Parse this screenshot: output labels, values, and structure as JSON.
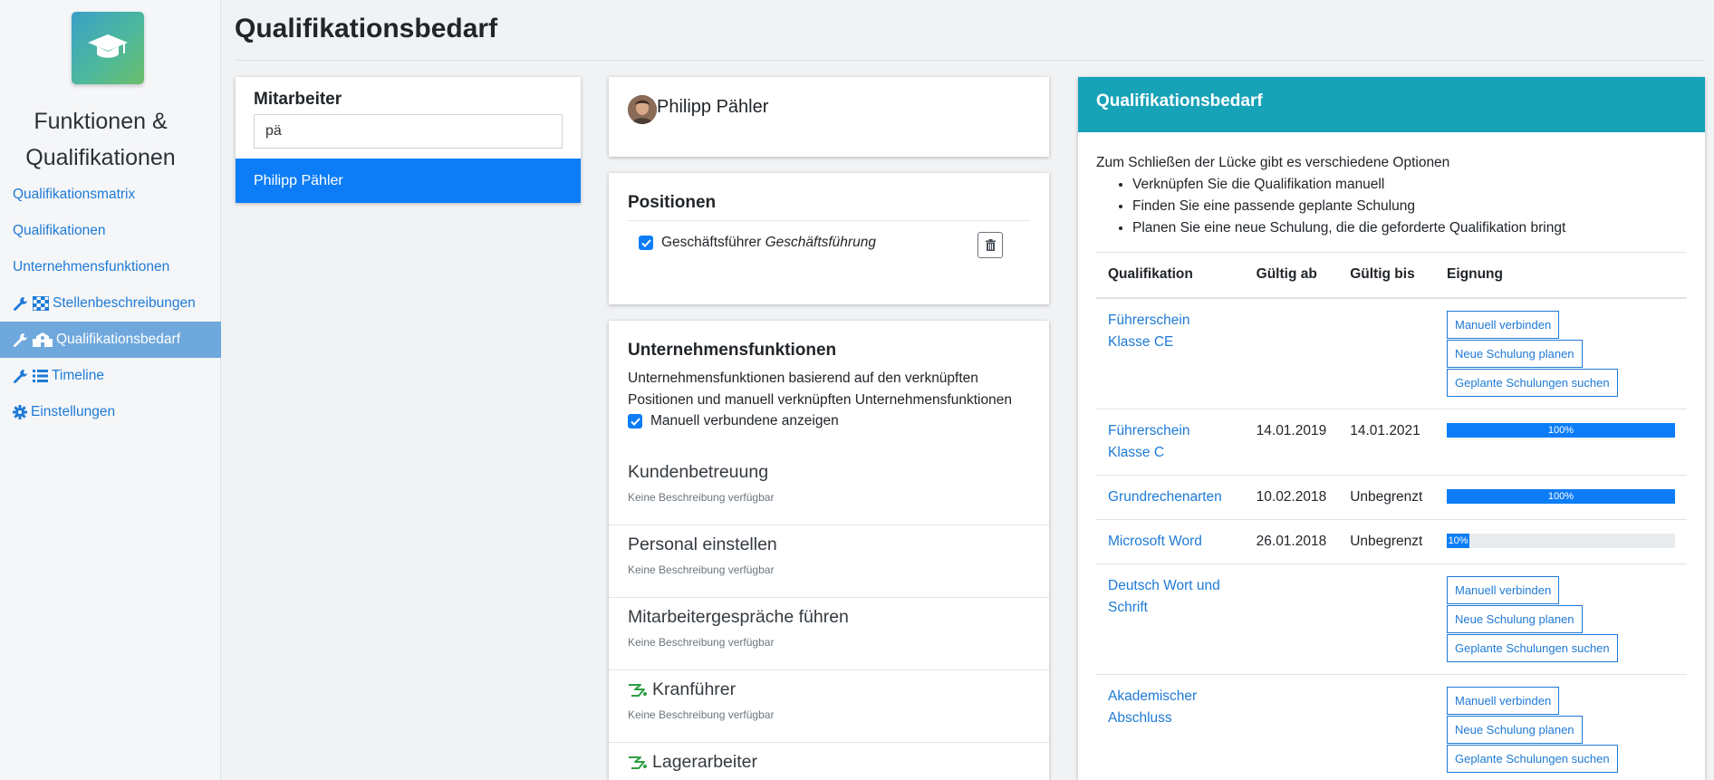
{
  "sidebar": {
    "app_title": "Funktionen & Qualifikationen",
    "items": [
      {
        "label": "Qualifikationsmatrix"
      },
      {
        "label": "Qualifikationen"
      },
      {
        "label": "Unternehmensfunktionen"
      },
      {
        "label": "Stellenbeschreibungen"
      },
      {
        "label": "Qualifikationsbedarf"
      },
      {
        "label": "Timeline"
      },
      {
        "label": "Einstellungen"
      }
    ]
  },
  "header": {
    "title": "Qualifikationsbedarf"
  },
  "mitarbeiter": {
    "heading": "Mitarbeiter",
    "search_value": "pä",
    "result": "Philipp Pähler"
  },
  "person": {
    "name": "Philipp Pähler"
  },
  "positionen": {
    "heading": "Positionen",
    "position": "Geschäftsführer",
    "department": "Geschäftsführung"
  },
  "unternehmensfunktionen": {
    "heading": "Unternehmensfunktionen",
    "description": "Unternehmensfunktionen basierend auf den verknüpften Positionen und manuell verknüpften Unternehmensfunktionen",
    "checkbox_label": "Manuell verbundene anzeigen",
    "items": [
      {
        "name": "Kundenbetreuung",
        "sub": "Keine Beschreibung verfügbar"
      },
      {
        "name": "Personal einstellen",
        "sub": "Keine Beschreibung verfügbar"
      },
      {
        "name": "Mitarbeitergespräche führen",
        "sub": "Keine Beschreibung verfügbar"
      },
      {
        "name": "Kranführer",
        "sub": "Keine Beschreibung verfügbar"
      },
      {
        "name": "Lagerarbeiter",
        "sub": ""
      }
    ]
  },
  "qualifikationsbedarf": {
    "heading": "Qualifikationsbedarf",
    "intro": "Zum Schließen der Lücke gibt es verschiedene Optionen",
    "options": [
      "Verknüpfen Sie die Qualifikation manuell",
      "Finden Sie eine passende geplante Schulung",
      "Planen Sie eine neue Schulung, die die geforderte Qualifikation bringt"
    ],
    "columns": [
      "Qualifikation",
      "Gültig ab",
      "Gültig bis",
      "Eignung"
    ],
    "buttons": {
      "connect": "Manuell verbinden",
      "plan": "Neue Schulung planen",
      "search": "Geplante Schulungen suchen"
    },
    "rows": [
      {
        "name": "Führerschein Klasse CE",
        "from": "",
        "to": ""
      },
      {
        "name": "Führerschein Klasse C",
        "from": "14.01.2019",
        "to": "14.01.2021",
        "progress_label": "100%"
      },
      {
        "name": "Grundrechenarten",
        "from": "10.02.2018",
        "to": "Unbegrenzt",
        "progress_label": "100%"
      },
      {
        "name": "Microsoft Word",
        "from": "26.01.2018",
        "to": "Unbegrenzt",
        "progress_label": "10%"
      },
      {
        "name": "Deutsch Wort und Schrift",
        "from": "",
        "to": ""
      },
      {
        "name": "Akademischer Abschluss",
        "from": "",
        "to": ""
      }
    ]
  },
  "colors": {
    "primary": "#0d7df7",
    "link": "#1e7ad6",
    "teal": "#17a2b8",
    "sidebar_active": "#6fa8dc",
    "icon_green": "#2e9e44"
  },
  "progress_values": [
    100,
    100,
    10
  ]
}
